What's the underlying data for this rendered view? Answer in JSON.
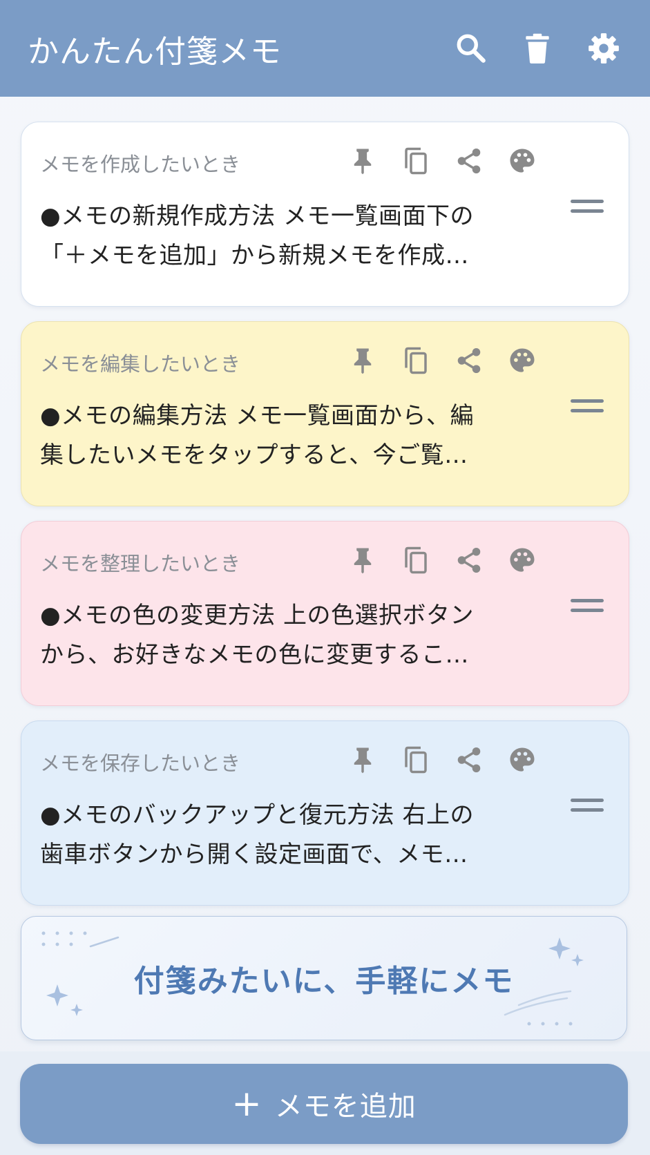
{
  "header": {
    "title": "かんたん付箋メモ",
    "icons": [
      "search-icon",
      "trash-icon",
      "gear-icon"
    ]
  },
  "memos": [
    {
      "meta": "メモを作成したいとき",
      "line1": "●メモの新規作成方法 メモ一覧画面下の",
      "line2": "「＋メモを追加」から新規メモを作成…",
      "color": "#ffffff"
    },
    {
      "meta": "メモを編集したいとき",
      "line1": "●メモの編集方法 メモ一覧画面から、編",
      "line2": "集したいメモをタップすると、今ご覧…",
      "color": "#fdf5c9"
    },
    {
      "meta": "メモを整理したいとき",
      "line1": "●メモの色の変更方法 上の色選択ボタン",
      "line2": "から、お好きなメモの色に変更するこ…",
      "color": "#fde4ea"
    },
    {
      "meta": "メモを保存したいとき",
      "line1": "●メモのバックアップと復元方法 右上の",
      "line2": "歯車ボタンから開く設定画面で、メモ…",
      "color": "#e2eefa"
    }
  ],
  "card_action_icons": [
    "pin-icon",
    "copy-icon",
    "share-icon",
    "palette-icon"
  ],
  "banner": {
    "text": "付箋みたいに、手軽にメモ"
  },
  "footer": {
    "plus": "+",
    "add_label": "メモを追加"
  },
  "colors": {
    "primary": "#7b9cc6",
    "banner_text": "#4e79b3",
    "icon_gray": "#8a8a8a"
  }
}
